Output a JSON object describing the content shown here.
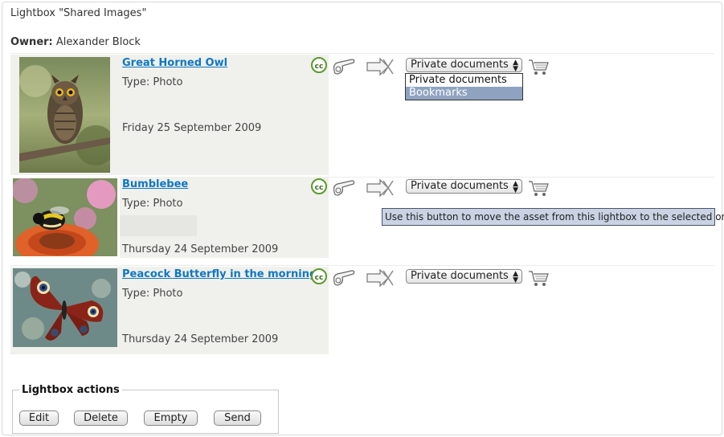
{
  "lightbox": {
    "title": "Lightbox \"Shared Images\""
  },
  "owner": {
    "label": "Owner:",
    "name": "Alexander Block"
  },
  "items": [
    {
      "title": "Great Horned Owl",
      "type": "Type: Photo",
      "date": "Friday 25 September 2009",
      "target_select": "Private documents"
    },
    {
      "title": "Bumblebee",
      "type": "Type: Photo",
      "date": "Thursday 24 September 2009",
      "target_select": "Private documents"
    },
    {
      "title": "Peacock Butterfly in the morning",
      "type": "Type: Photo",
      "date": "Thursday 24 September 2009",
      "target_select": "Private documents"
    }
  ],
  "dropdown": {
    "options": [
      "Private documents",
      "Bookmarks"
    ],
    "highlighted": "Bookmarks"
  },
  "tooltip": "Use this button to move the asset from this lightbox to the selected one",
  "actions": {
    "legend": "Lightbox actions",
    "buttons": [
      "Edit",
      "Delete",
      "Empty",
      "Send"
    ]
  },
  "icons": {
    "license": "creative-commons-icon",
    "copy": "copy-to-lightbox-icon",
    "move": "move-to-lightbox-icon",
    "cart": "shopping-cart-icon"
  },
  "colors": {
    "link": "#0e77c4",
    "cell_bg": "#f0f0ec",
    "highlight": "#8fa3c0",
    "tooltip_bg": "#c9d3e3"
  }
}
